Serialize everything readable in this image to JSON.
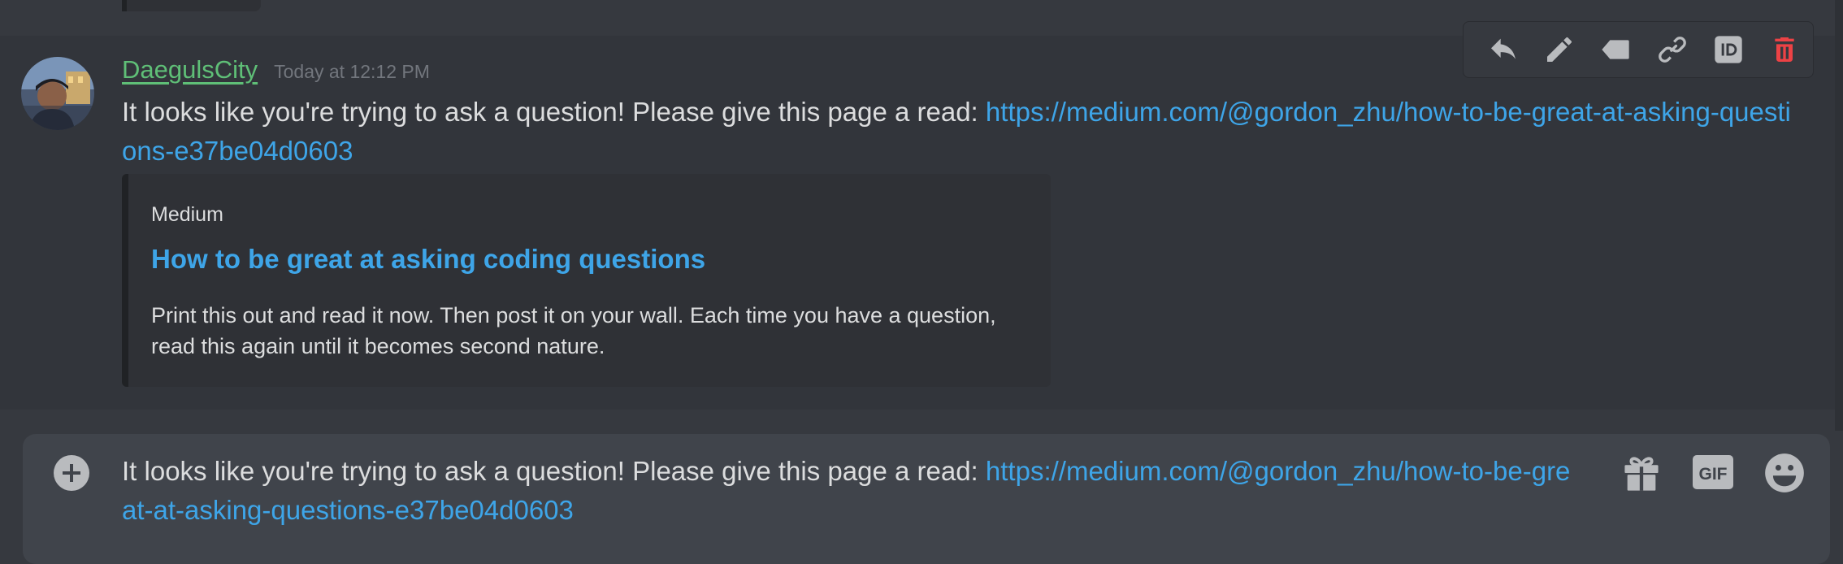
{
  "message": {
    "username": "DaegulsCity",
    "timestamp": "Today at 12:12 PM",
    "text": "It looks like you're trying to ask a question! Please give this page a read: ",
    "link": "https://medium.com/@gordon_zhu/how-to-be-great-at-asking-questions-e37be04d0603",
    "username_color": "#5fbf77"
  },
  "embed": {
    "provider": "Medium",
    "title": "How to be great at asking coding questions",
    "description": "Print this out and read it now. Then post it on your wall. Each time you have a question, read this again until it becomes second nature."
  },
  "toolbar": {
    "icons": [
      "reply-icon",
      "edit-icon",
      "tag-icon",
      "link-icon",
      "id-icon",
      "delete-icon"
    ],
    "delete_color": "#ed4245"
  },
  "composer": {
    "text": "It looks like you're trying to ask a question! Please give this page a read: ",
    "link": "https://medium.com/@gordon_zhu/how-to-be-great-at-asking-questions-e37be04d0603",
    "gif_label": "GIF",
    "icons": [
      "add-icon",
      "gift-icon",
      "gif-icon",
      "emoji-icon"
    ]
  },
  "colors": {
    "background": "#36393f",
    "link": "#3ea5e8",
    "embed_background": "#2f3136",
    "composer_background": "#40444b"
  }
}
